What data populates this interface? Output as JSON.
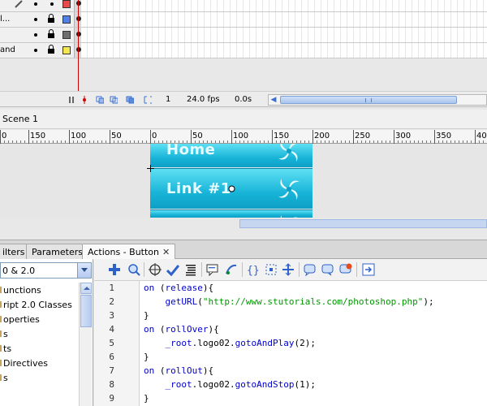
{
  "timeline": {
    "layers": [
      {
        "name": "l...",
        "color": "#4f82e6"
      },
      {
        "name": "",
        "color": "#6f6f6f"
      },
      {
        "name": "and",
        "color": "#f4e84e"
      }
    ],
    "top_swatch_color": "#e84a4a",
    "frame": "1",
    "fps": "24.0 fps",
    "elapsed": "0.0s"
  },
  "scene": {
    "label": "Scene 1"
  },
  "ruler": {
    "ticks": [
      "0",
      "150",
      "100",
      "50",
      "0",
      "50",
      "100",
      "150",
      "200",
      "250",
      "300",
      "350",
      "40"
    ]
  },
  "stage": {
    "buttons": [
      {
        "label": "Home"
      },
      {
        "label": "Link #1"
      },
      {
        "label": ""
      }
    ]
  },
  "panel_tabs": [
    {
      "label": "ilters",
      "active": false
    },
    {
      "label": "Parameters",
      "active": false
    },
    {
      "label": "Actions - Button",
      "active": true
    }
  ],
  "actions_panel": {
    "version": "0 & 2.0",
    "toolbox_items": [
      "unctions",
      "ript 2.0 Classes",
      "operties",
      "s",
      "ts",
      "Directives",
      "s"
    ],
    "toolbar_icons": [
      "add-statement-icon",
      "find-icon",
      "insert-target-path-icon",
      "check-syntax-icon",
      "auto-format-icon",
      "show-code-hint-icon",
      "debug-options-icon",
      "collapse-between-braces-icon",
      "collapse-selection-icon",
      "expand-all-icon",
      "apply-block-comment-icon",
      "apply-line-comment-icon",
      "remove-comment-icon",
      "script-assist-icon"
    ],
    "code_lines": [
      {
        "num": "1",
        "indent": "",
        "parts": [
          {
            "t": "on",
            "c": "kw"
          },
          {
            "t": " (",
            "c": "id"
          },
          {
            "t": "release",
            "c": "kw"
          },
          {
            "t": "){",
            "c": "id"
          }
        ]
      },
      {
        "num": "2",
        "indent": "    ",
        "parts": [
          {
            "t": "getURL",
            "c": "fn"
          },
          {
            "t": "(",
            "c": "id"
          },
          {
            "t": "\"http://www.stutorials.com/photoshop.php\"",
            "c": "str"
          },
          {
            "t": ");",
            "c": "id"
          }
        ]
      },
      {
        "num": "3",
        "indent": "",
        "parts": [
          {
            "t": "}",
            "c": "id"
          }
        ]
      },
      {
        "num": "4",
        "indent": "",
        "parts": [
          {
            "t": "on",
            "c": "kw"
          },
          {
            "t": " (",
            "c": "id"
          },
          {
            "t": "rollOver",
            "c": "kw"
          },
          {
            "t": "){",
            "c": "id"
          }
        ]
      },
      {
        "num": "5",
        "indent": "    ",
        "parts": [
          {
            "t": "_root",
            "c": "fn"
          },
          {
            "t": ".logo02.",
            "c": "id"
          },
          {
            "t": "gotoAndPlay",
            "c": "fn"
          },
          {
            "t": "(2);",
            "c": "id"
          }
        ]
      },
      {
        "num": "6",
        "indent": "",
        "parts": [
          {
            "t": "}",
            "c": "id"
          }
        ]
      },
      {
        "num": "7",
        "indent": "",
        "parts": [
          {
            "t": "on",
            "c": "kw"
          },
          {
            "t": " (",
            "c": "id"
          },
          {
            "t": "rollOut",
            "c": "kw"
          },
          {
            "t": "){",
            "c": "id"
          }
        ]
      },
      {
        "num": "8",
        "indent": "    ",
        "parts": [
          {
            "t": "_root",
            "c": "fn"
          },
          {
            "t": ".logo02.",
            "c": "id"
          },
          {
            "t": "gotoAndStop",
            "c": "fn"
          },
          {
            "t": "(1);",
            "c": "id"
          }
        ]
      },
      {
        "num": "9",
        "indent": "",
        "parts": [
          {
            "t": "}",
            "c": "id"
          }
        ]
      }
    ]
  }
}
